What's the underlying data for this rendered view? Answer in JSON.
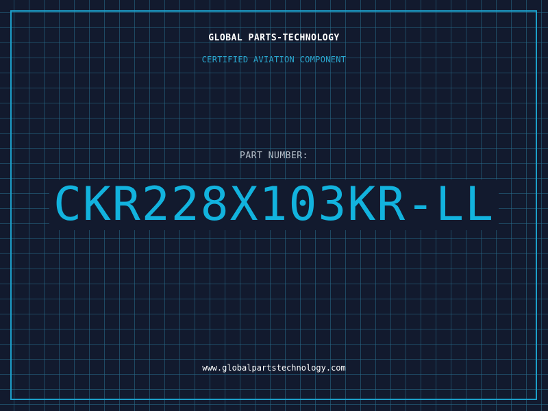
{
  "brand": {
    "name": "GLOBAL PARTS-TECHNOLOGY",
    "tagline": "CERTIFIED AVIATION COMPONENT"
  },
  "part": {
    "label": "PART NUMBER:",
    "number": "CKR228X103KR-LL"
  },
  "footer": {
    "url": "www.globalpartstechnology.com"
  },
  "colors": {
    "background": "#121a2e",
    "grid": "#286e8c",
    "accent": "#12b3de",
    "frame": "#1c9fc9",
    "text": "#ffffff"
  }
}
